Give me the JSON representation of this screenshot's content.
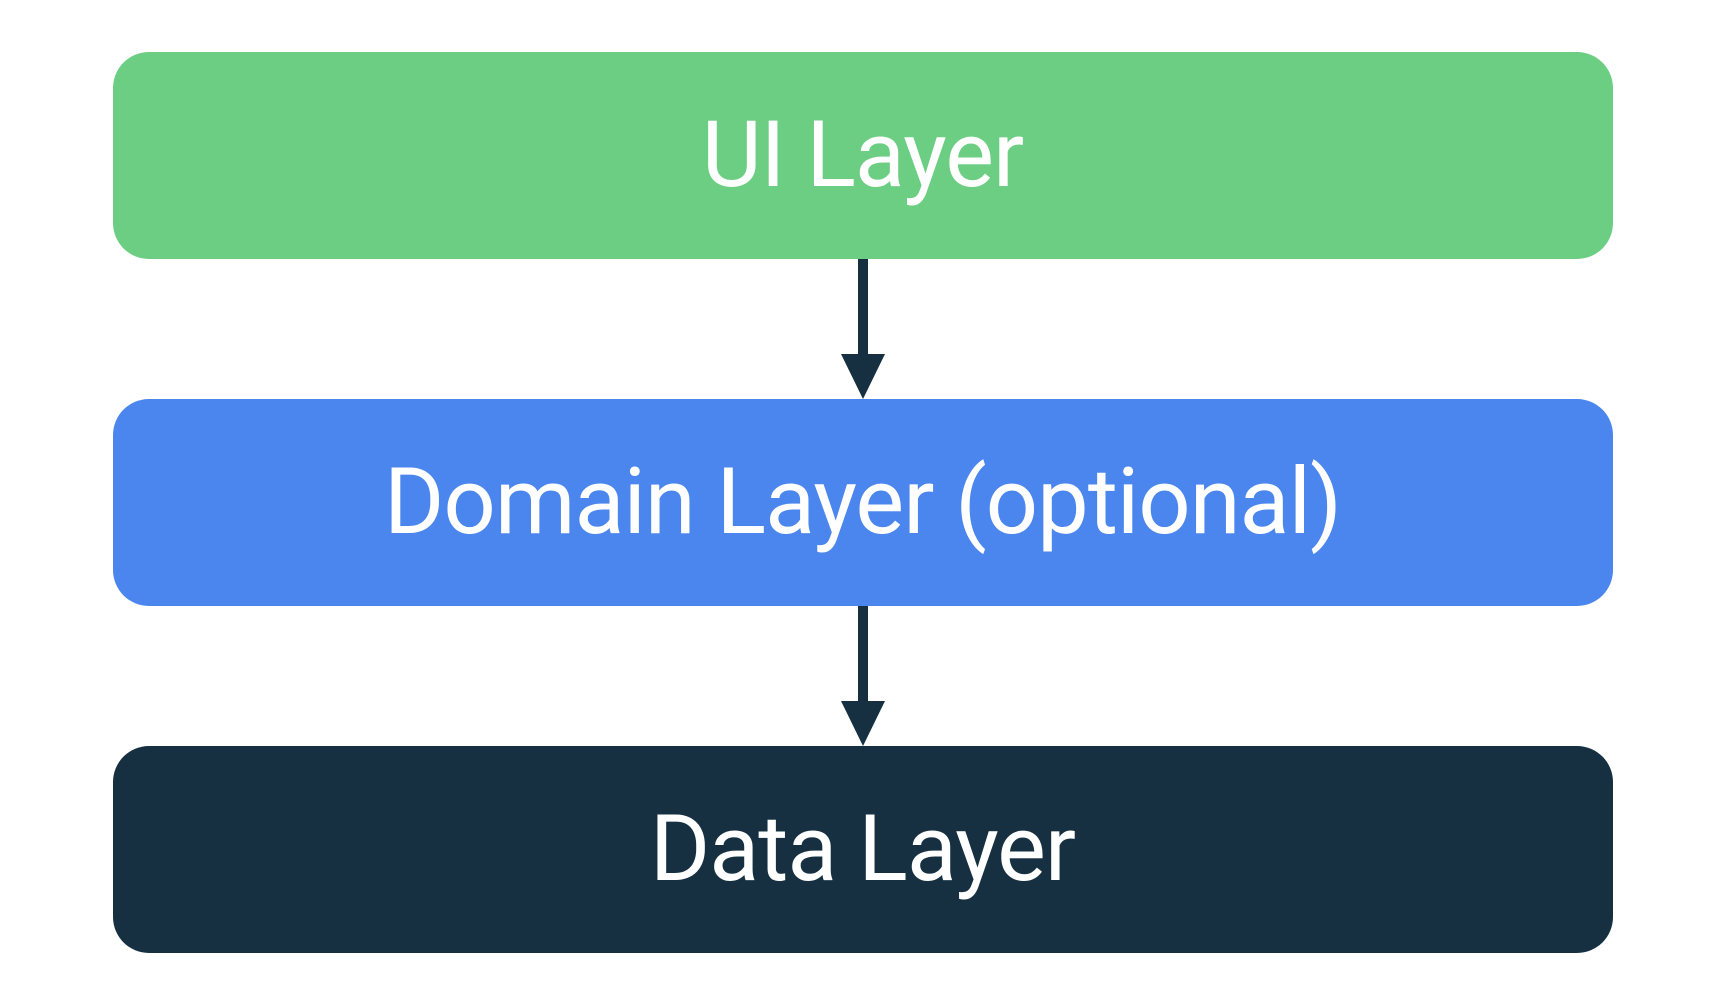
{
  "layers": {
    "ui": {
      "label": "UI Layer",
      "color": "#6cce83"
    },
    "domain": {
      "label": "Domain Layer (optional)",
      "color": "#4a86ee"
    },
    "data": {
      "label": "Data Layer",
      "color": "#163041"
    }
  },
  "arrowColor": "#163041"
}
